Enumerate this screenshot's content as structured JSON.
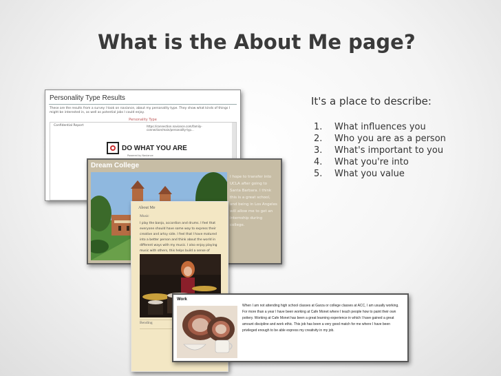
{
  "slide": {
    "title": "What is the About Me page?",
    "intro": "It's a place to describe:",
    "items": [
      {
        "num": "1.",
        "text": "What influences you"
      },
      {
        "num": "2.",
        "text": "Who you are as a person"
      },
      {
        "num": "3.",
        "text": "What's important to you"
      },
      {
        "num": "4.",
        "text": "What you're into"
      },
      {
        "num": "5.",
        "text": "What you value"
      }
    ]
  },
  "shot1": {
    "header": "Personality Type Results",
    "description": "These are the results from a survey I took on naviance, about my personality type. They show what kinds of things I might be interested in, as well as potential jobs I could enjoy.",
    "link": "Personality Type",
    "report_label": "Confidential Report",
    "report_url": "https://connection.naviance.com/family-connection/main/personality-typ...",
    "logo_text": "DO WHAT YOU ARE",
    "logo_sub": "Powered by Naviance"
  },
  "shot2": {
    "title": "Dream College",
    "text": "I hope to transfer into UCLA after going to Santa Barbara. I think this is a great school, and being in Los Angeles will allow me to get an internship during college."
  },
  "shot3": {
    "heading": "About Me",
    "music_label": "Music",
    "body": "I play the banjo, accordion and drums. I feel that everyone should have some way to express their creative and artsy side. I feel that I have matured into a better person and think about the world in different ways with my music. I also enjoy playing music with others, this helps build a sense of community.",
    "bottom_label": "Bending"
  },
  "shot4": {
    "heading": "Work",
    "text": "When I am not attending high school classes at Garza or college classes at ACC, I am usually working. For more than a year I have been working at Cafe Monet where I teach people how to paint their own pottery. Working at Cafe Monet has been a great learning experience in which I have gained a great amount discipline and work ethic. This job has been a very good match for me where I have been privileged enough to be able express my creativity in my job."
  }
}
